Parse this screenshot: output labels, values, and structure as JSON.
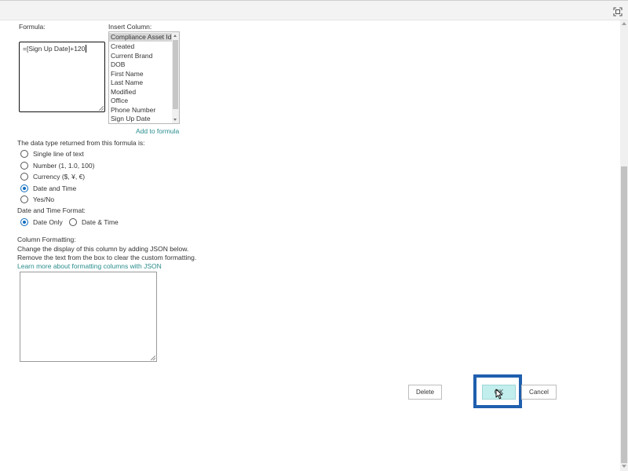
{
  "formula": {
    "label": "Formula:",
    "value": "=[Sign Up Date]+120"
  },
  "insert_column": {
    "label": "Insert Column:",
    "items": [
      "Compliance Asset Id",
      "Created",
      "Current Brand",
      "DOB",
      "First Name",
      "Last Name",
      "Modified",
      "Office",
      "Phone Number",
      "Sign Up Date"
    ],
    "selected": "Compliance Asset Id",
    "add_link": "Add to formula"
  },
  "data_type": {
    "label": "The data type returned from this formula is:",
    "options": [
      "Single line of text",
      "Number (1, 1.0, 100)",
      "Currency ($, ¥, €)",
      "Date and Time",
      "Yes/No"
    ],
    "selected": "Date and Time"
  },
  "date_format": {
    "label": "Date and Time Format:",
    "options": [
      "Date Only",
      "Date & Time"
    ],
    "selected": "Date Only"
  },
  "column_formatting": {
    "label": "Column Formatting:",
    "desc1": "Change the display of this column by adding JSON below.",
    "desc2": "Remove the text from the box to clear the custom formatting.",
    "learn_link": "Learn more about formatting columns with JSON",
    "json_value": ""
  },
  "buttons": {
    "delete": "Delete",
    "ok": "OK",
    "cancel": "Cancel"
  },
  "colors": {
    "link": "#2a8c8c",
    "radio_checked": "#0f6cbd",
    "ok_highlight": "#1f5fae",
    "ok_button": "#c3eeee"
  }
}
